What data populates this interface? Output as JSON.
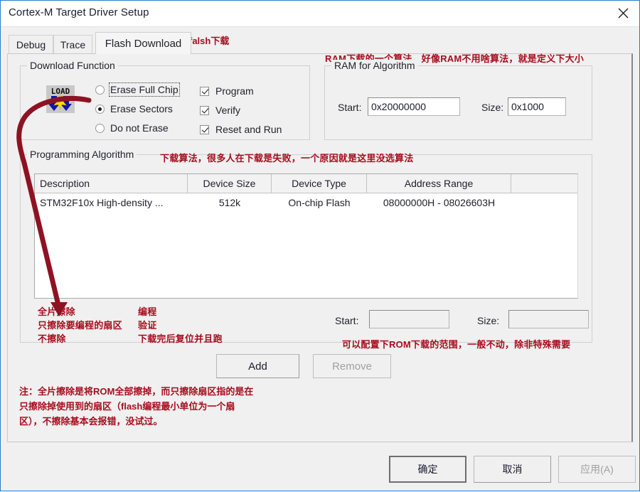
{
  "window": {
    "title": "Cortex-M Target Driver Setup",
    "close_icon": "close-icon"
  },
  "tabs": [
    {
      "label": "Debug",
      "selected": false
    },
    {
      "label": "Trace",
      "selected": false
    },
    {
      "label": "Flash Download",
      "selected": true
    }
  ],
  "tab_annotation": "falsh下载",
  "download_function": {
    "title": "Download Function",
    "icon": "load-icon",
    "erase_options": [
      {
        "label": "Erase Full Chip",
        "selected": false,
        "focused": true
      },
      {
        "label": "Erase Sectors",
        "selected": true,
        "focused": false
      },
      {
        "label": "Do not Erase",
        "selected": false,
        "focused": false
      }
    ],
    "checkboxes": [
      {
        "label": "Program",
        "checked": true
      },
      {
        "label": "Verify",
        "checked": true
      },
      {
        "label": "Reset and Run",
        "checked": true
      }
    ]
  },
  "ram_for_algorithm": {
    "title": "RAM for Algorithm",
    "annotation": "RAM下载的一个算法，好像RAM不用啥算法，就是定义下大小",
    "start_label": "Start:",
    "start_value": "0x20000000",
    "size_label": "Size:",
    "size_value": "0x1000"
  },
  "programming_algorithm": {
    "title": "Programming Algorithm",
    "annotation": "下载算法，很多人在下载是失败，一个原因就是这里没选算法",
    "columns": [
      "Description",
      "Device Size",
      "Device Type",
      "Address Range",
      ""
    ],
    "rows": [
      {
        "description": "STM32F10x High-density ...",
        "device_size": "512k",
        "device_type": "On-chip Flash",
        "address_range": "08000000H - 08026603H"
      }
    ],
    "start_label": "Start:",
    "start_value": "",
    "size_label": "Size:",
    "size_value": "",
    "range_annotation": "可以配置下ROM下载的范围，一般不动，除非特殊需要",
    "add_label": "Add",
    "remove_label": "Remove",
    "remove_disabled": true
  },
  "erase_annotations": {
    "line1": "全片擦除",
    "line2": "只擦除要编程的扇区",
    "line3": "不擦除"
  },
  "function_annotations": {
    "line1": "编程",
    "line2": "验证",
    "line3": "下载完后复位并且跑"
  },
  "note": {
    "line1": "注：全片擦除是将ROM全部擦掉，而只擦除扇区指的是在",
    "line2": "只擦除掉使用到的扇区（flash编程最小单位为一个扇",
    "line3": "区），不擦除基本会报错，没试过。"
  },
  "dialog_buttons": [
    {
      "label": "确定",
      "default": true,
      "disabled": false
    },
    {
      "label": "取消",
      "default": false,
      "disabled": false
    },
    {
      "label": "应用(A)",
      "default": false,
      "disabled": true
    }
  ],
  "colors": {
    "annotation_red": "#a50d1d",
    "title_border": "#2a7cc7",
    "dialog_bg": "#f0f0f0"
  }
}
